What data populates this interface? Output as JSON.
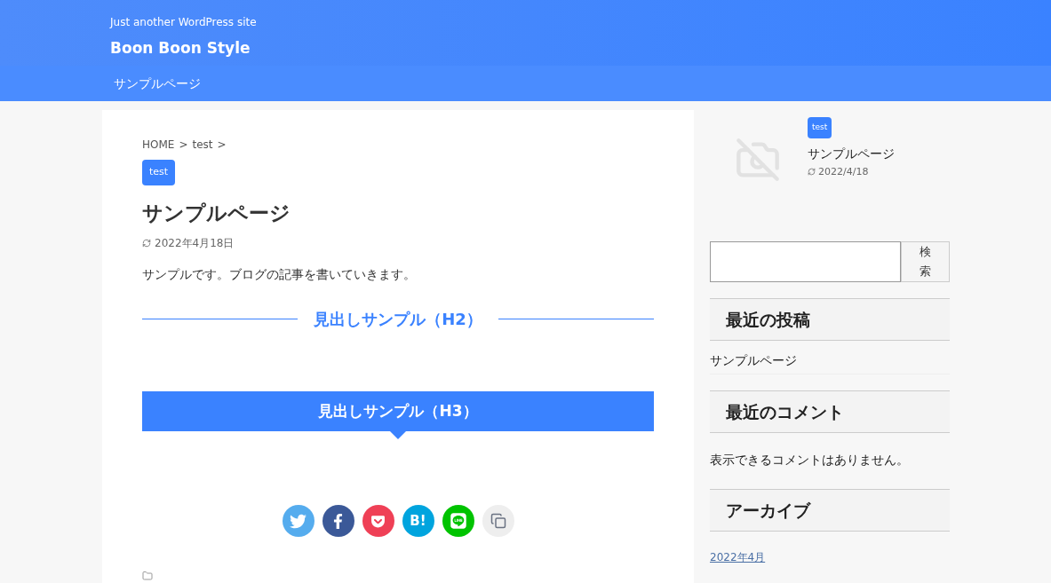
{
  "header": {
    "tagline": "Just another WordPress site",
    "site_title": "Boon Boon Style"
  },
  "nav": {
    "items": [
      {
        "label": "サンプルページ"
      }
    ]
  },
  "article": {
    "breadcrumb": [
      {
        "label": "HOME"
      },
      {
        "label": "test"
      }
    ],
    "separator": ">",
    "category": "test",
    "title": "サンプルページ",
    "date": "2022年4月18日",
    "body": "サンプルです。ブログの記事を書いていきます。",
    "h2": "見出しサンプル（H2）",
    "h3": "見出しサンプル（H3）",
    "share": [
      {
        "kind": "twitter",
        "color": "#55acee"
      },
      {
        "kind": "facebook",
        "color": "#3b5998"
      },
      {
        "kind": "pocket",
        "color": "#ef4056"
      },
      {
        "kind": "hatena",
        "color": "#00a4de",
        "label": "B!"
      },
      {
        "kind": "line",
        "color": "#00c300"
      },
      {
        "kind": "copy",
        "color": "#eeeeee"
      }
    ]
  },
  "sidebar": {
    "featured": {
      "category": "test",
      "title": "サンプルページ",
      "date": "2022/4/18"
    },
    "search": {
      "button": "検索"
    },
    "widgets": [
      {
        "title": "最近の投稿",
        "items": [
          {
            "kind": "text",
            "text": "サンプルページ"
          }
        ]
      },
      {
        "title": "最近のコメント",
        "items": [
          {
            "kind": "note",
            "text": "表示できるコメントはありません。"
          }
        ]
      },
      {
        "title": "アーカイブ",
        "items": [
          {
            "kind": "link",
            "text": "2022年4月"
          }
        ]
      }
    ]
  }
}
